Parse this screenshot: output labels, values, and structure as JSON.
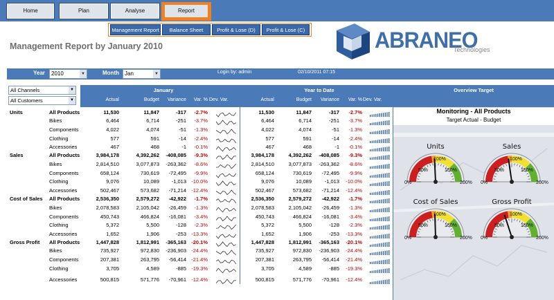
{
  "nav": {
    "tabs": [
      {
        "label": "Home"
      },
      {
        "label": "Plan"
      },
      {
        "label": "Analyse"
      },
      {
        "label": "Report"
      }
    ],
    "subtabs": [
      {
        "label": "Management Report"
      },
      {
        "label": "Balance Sheet"
      },
      {
        "label": "Profit & Lose (D)"
      },
      {
        "label": "Profit & Lose (C)"
      }
    ]
  },
  "page": {
    "title": "Management Report by January 2010"
  },
  "logo": {
    "name": "ABRANEO",
    "tagline": "Technologies",
    "color": "#3f6fa8"
  },
  "filters": {
    "year_label": "Year",
    "year_value": "2010",
    "month_label": "Month",
    "month_value": "Jan",
    "login": "Login by: admin",
    "datetime": "02/10/2011 07:15"
  },
  "selectors": {
    "channels": "All Channels",
    "customers": "All Customers"
  },
  "headers": {
    "january": "January",
    "ytd": "Year to Date",
    "overview": "Overview Target",
    "cols": [
      "Actual",
      "Budget",
      "Variance",
      "Var. %",
      "Dev. Var."
    ]
  },
  "rows": [
    {
      "group": "Units",
      "product": "All Products",
      "a": "11,530",
      "b": "11,847",
      "v": "-317",
      "p": "-2.7%",
      "ya": "11,530",
      "yb": "11,847",
      "yv": "-317",
      "yp": "-2.7%"
    },
    {
      "group": "",
      "product": "Bikes",
      "a": "6,464",
      "b": "6,714",
      "v": "-251",
      "p": "-3.7%",
      "ya": "6,464",
      "yb": "6,714",
      "yv": "-251",
      "yp": "-3.7%"
    },
    {
      "group": "",
      "product": "Components",
      "a": "4,022",
      "b": "4,074",
      "v": "-51",
      "p": "-1.3%",
      "ya": "4,022",
      "yb": "4,074",
      "yv": "-51",
      "yp": "-1.3%"
    },
    {
      "group": "",
      "product": "Clothing",
      "a": "577",
      "b": "591",
      "v": "-14",
      "p": "-2.4%",
      "ya": "577",
      "yb": "591",
      "yv": "-14",
      "yp": "-2.4%"
    },
    {
      "group": "",
      "product": "Accessories",
      "a": "467",
      "b": "468",
      "v": "-1",
      "p": "-0.1%",
      "ya": "467",
      "yb": "468",
      "yv": "-1",
      "yp": "-0.1%"
    },
    {
      "group": "Sales",
      "product": "All Products",
      "a": "3,984,178",
      "b": "4,392,262",
      "v": "-408,085",
      "p": "-9.3%",
      "ya": "3,984,178",
      "yb": "4,392,262",
      "yv": "-408,085",
      "yp": "-9.3%"
    },
    {
      "group": "",
      "product": "Bikes",
      "a": "2,814,510",
      "b": "3,077,873",
      "v": "-263,362",
      "p": "-8.6%",
      "ya": "2,814,510",
      "yb": "3,077,873",
      "yv": "-263,362",
      "yp": "-8.6%"
    },
    {
      "group": "",
      "product": "Components",
      "a": "658,124",
      "b": "730,619",
      "v": "-72,495",
      "p": "-9.9%",
      "ya": "658,124",
      "yb": "730,619",
      "yv": "-72,495",
      "yp": "-9.9%"
    },
    {
      "group": "",
      "product": "Clothing",
      "a": "9,076",
      "b": "10,089",
      "v": "-1,013",
      "p": "-10.0%",
      "ya": "9,076",
      "yb": "10,089",
      "yv": "-1,013",
      "yp": "-10.0%"
    },
    {
      "group": "",
      "product": "Accessories",
      "a": "502,467",
      "b": "573,682",
      "v": "-71,214",
      "p": "-12.4%",
      "ya": "502,467",
      "yb": "573,682",
      "yv": "-71,214",
      "yp": "-12.4%"
    },
    {
      "group": "Cost of Sales",
      "product": "All Products",
      "a": "2,536,350",
      "b": "2,579,272",
      "v": "-42,922",
      "p": "-1.7%",
      "ya": "2,536,350",
      "yb": "2,579,272",
      "yv": "-42,922",
      "yp": "-1.7%"
    },
    {
      "group": "",
      "product": "Bikes",
      "a": "2,078,583",
      "b": "2,105,042",
      "v": "-26,459",
      "p": "-1.3%",
      "ya": "2,078,583",
      "yb": "2,105,042",
      "yv": "-26,459",
      "yp": "-1.3%"
    },
    {
      "group": "",
      "product": "Components",
      "a": "450,743",
      "b": "466,824",
      "v": "-16,081",
      "p": "-3.4%",
      "ya": "450,743",
      "yb": "466,824",
      "yv": "-16,081",
      "yp": "-3.4%"
    },
    {
      "group": "",
      "product": "Clothing",
      "a": "5,372",
      "b": "5,500",
      "v": "-128",
      "p": "-2.3%",
      "ya": "5,372",
      "yb": "5,500",
      "yv": "-128",
      "yp": "-2.3%"
    },
    {
      "group": "",
      "product": "Accessories",
      "a": "1,652",
      "b": "1,906",
      "v": "-253",
      "p": "-13.3%",
      "ya": "1,652",
      "yb": "1,906",
      "yv": "-253",
      "yp": "-13.3%"
    },
    {
      "group": "Gross Profit",
      "product": "All Products",
      "a": "1,447,828",
      "b": "1,812,991",
      "v": "-365,163",
      "p": "-20.1%",
      "ya": "1,447,828",
      "yb": "1,812,991",
      "yv": "-365,163",
      "yp": "-20.1%"
    },
    {
      "group": "",
      "product": "Bikes",
      "a": "735,927",
      "b": "972,830",
      "v": "-236,903",
      "p": "-24.4%",
      "ya": "735,927",
      "yb": "972,830",
      "yv": "-236,903",
      "yp": "-24.4%"
    },
    {
      "group": "",
      "product": "Components",
      "a": "207,381",
      "b": "263,795",
      "v": "-56,414",
      "p": "-21.4%",
      "ya": "207,381",
      "yb": "263,795",
      "yv": "-56,414",
      "yp": "-21.4%"
    },
    {
      "group": "",
      "product": "Clothing",
      "a": "3,705",
      "b": "4,589",
      "v": "-885",
      "p": "-19.3%",
      "ya": "3,705",
      "yb": "4,589",
      "yv": "-885",
      "yp": "-19.3%"
    },
    {
      "group": "",
      "product": "Accessories",
      "a": "500,815",
      "b": "571,776",
      "v": "-70,961",
      "p": "-12.4%",
      "ya": "500,815",
      "yb": "571,776",
      "yv": "-70,961",
      "yp": "-12.4%"
    }
  ],
  "overview": {
    "title": "Monitoring - All Products",
    "subtitle": "Target Actual - Budget",
    "gauges": [
      {
        "label": "Units",
        "ticks": [
          "0%",
          "50%",
          "100%",
          "150%",
          "200%"
        ],
        "value_pct": 97
      },
      {
        "label": "Sales",
        "ticks": [
          "0%",
          "50%",
          "100%",
          "150%",
          "200%"
        ],
        "value_pct": 91
      },
      {
        "label": "Cost of Sales",
        "ticks": [
          "0%",
          "50%",
          "100%",
          "150%",
          "200%"
        ],
        "value_pct": 98
      },
      {
        "label": "Gross Profit",
        "ticks": [
          "0%",
          "50%",
          "100%",
          "150%",
          "200%"
        ],
        "value_pct": 80
      }
    ]
  },
  "colors": {
    "bar": "#4a7ab8",
    "accent": "#f08020",
    "negative": "#c00000"
  }
}
